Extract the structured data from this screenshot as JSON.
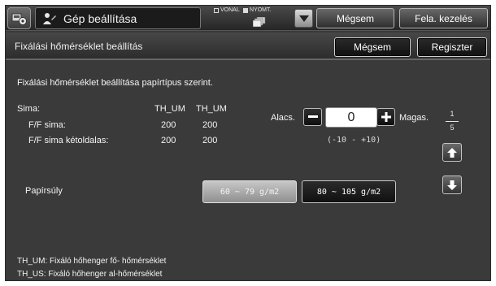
{
  "header": {
    "title": "Gép beállítása",
    "mode_line": "VONAL",
    "mode_print": "NYOMT.",
    "cancel_label": "Mégsem",
    "job_status_label": "Fela. kezelés"
  },
  "subheader": {
    "title": "Fixálási hőmérséklet beállítás",
    "cancel_label": "Mégsem",
    "register_label": "Regiszter"
  },
  "main": {
    "instruction": "Fixálási hőmérséklet beállítása papírtípus szerint.",
    "col_headers": [
      "TH_UM",
      "TH_UM"
    ],
    "rows": [
      {
        "label": "Sima:",
        "values": [
          "",
          ""
        ]
      },
      {
        "label": "F/F sima:",
        "values": [
          "200",
          "200"
        ]
      },
      {
        "label": "F/F sima kétoldalas:",
        "values": [
          "200",
          "200"
        ]
      }
    ],
    "adjust": {
      "low_label": "Alacs.",
      "high_label": "Magas.",
      "value": "0",
      "range": "(-10 - +10)"
    },
    "page": {
      "current": "1",
      "total": "5"
    },
    "paper_weight": {
      "label": "Papírsúly",
      "options": [
        "60 ~ 79 g/m2",
        "80 ~ 105 g/m2"
      ],
      "selected": "60 ~ 79 g/m2"
    },
    "footnotes": [
      "TH_UM: Fixáló hőhenger fő- hőmérséklet",
      "TH_US: Fixáló hőhenger al-hőmérséklet"
    ]
  },
  "icons": [
    "settings-icon",
    "user-wrench-icon",
    "paper-stack-icon",
    "dropdown-arrow-icon",
    "minus-icon",
    "plus-icon",
    "arrow-up-icon",
    "arrow-down-icon"
  ]
}
